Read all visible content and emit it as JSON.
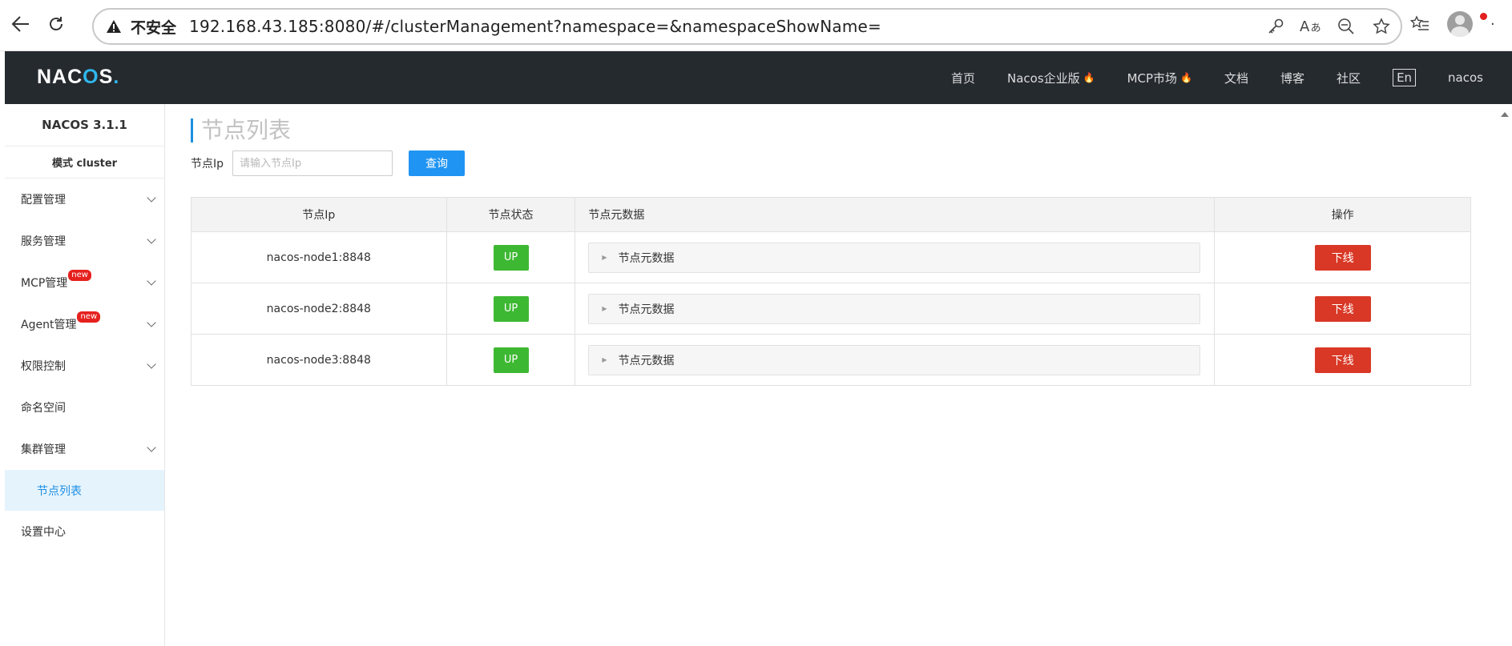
{
  "browser": {
    "not_secure": "不安全",
    "url": "192.168.43.185:8080/#/clusterManagement?namespace=&namespaceShowName="
  },
  "header": {
    "logo_a": "NAC",
    "logo_b": "O",
    "logo_c": "S",
    "logo_dot": ".",
    "nav": [
      {
        "label": "首页",
        "hot": false
      },
      {
        "label": "Nacos企业版",
        "hot": true
      },
      {
        "label": "MCP市场",
        "hot": true
      },
      {
        "label": "文档",
        "hot": false
      },
      {
        "label": "博客",
        "hot": false
      },
      {
        "label": "社区",
        "hot": false
      }
    ],
    "lang": "En",
    "user": "nacos"
  },
  "sidebar": {
    "version": "NACOS 3.1.1",
    "mode": "模式 cluster",
    "items": [
      {
        "label": "配置管理",
        "expandable": true,
        "badge": ""
      },
      {
        "label": "服务管理",
        "expandable": true,
        "badge": ""
      },
      {
        "label": "MCP管理",
        "expandable": true,
        "badge": "new"
      },
      {
        "label": "Agent管理",
        "expandable": true,
        "badge": "new"
      },
      {
        "label": "权限控制",
        "expandable": true,
        "badge": ""
      },
      {
        "label": "命名空间",
        "expandable": false,
        "badge": ""
      },
      {
        "label": "集群管理",
        "expandable": true,
        "badge": ""
      }
    ],
    "active_sub": "节点列表",
    "last_item": "设置中心"
  },
  "main": {
    "title": "节点列表",
    "search_label": "节点Ip",
    "search_placeholder": "请输入节点Ip",
    "search_value": "",
    "query_label": "查询",
    "columns": [
      "节点Ip",
      "节点状态",
      "节点元数据",
      "操作"
    ],
    "rows": [
      {
        "ip": "nacos-node1:8848",
        "status": "UP",
        "meta": "节点元数据",
        "action": "下线"
      },
      {
        "ip": "nacos-node2:8848",
        "status": "UP",
        "meta": "节点元数据",
        "action": "下线"
      },
      {
        "ip": "nacos-node3:8848",
        "status": "UP",
        "meta": "节点元数据",
        "action": "下线"
      }
    ]
  },
  "colors": {
    "header_bg": "#252a2f",
    "primary": "#2094f3",
    "status_up": "#3db832",
    "danger": "#d93826",
    "active_bg": "#e5f3fd"
  }
}
